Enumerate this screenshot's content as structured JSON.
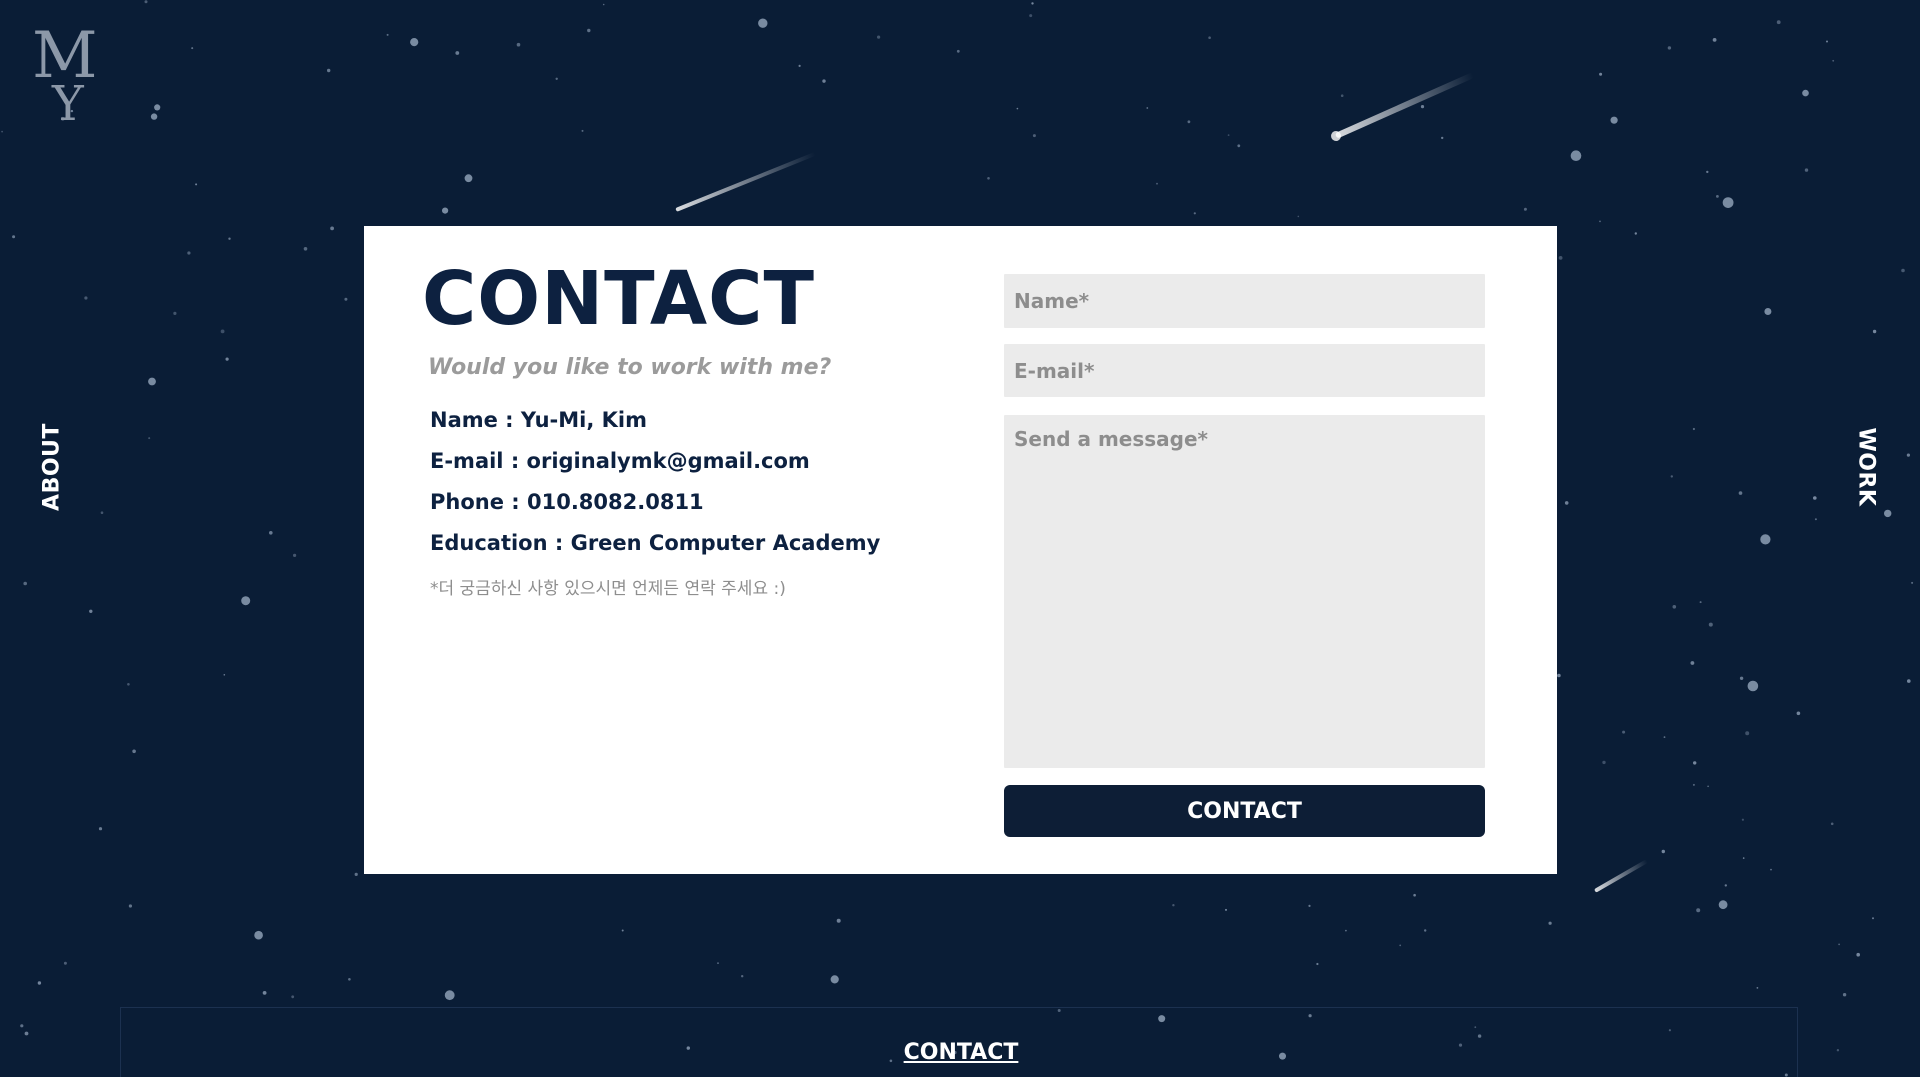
{
  "logo": {
    "letter_top": "M",
    "letter_bottom": "Y"
  },
  "nav": {
    "left_label": "ABOUT",
    "right_label": "WORK"
  },
  "contact": {
    "title": "CONTACT",
    "subtitle": "Would you like to work with me?",
    "info": [
      "Name : Yu-Mi, Kim",
      "E-mail : originalymk@gmail.com",
      "Phone : 010.8082.0811",
      "Education : Green Computer Academy"
    ],
    "note": "*더 궁금하신 사항 있으시면 언제든 연락 주세요 :)"
  },
  "form": {
    "name_placeholder": "Name*",
    "email_placeholder": "E-mail*",
    "message_placeholder": "Send a message*",
    "submit_label": "CONTACT"
  },
  "footer": {
    "link_label": "CONTACT"
  },
  "colors": {
    "background": "#0a1d36",
    "card": "#ffffff",
    "primary_text": "#0d2140",
    "field_bg": "#ebebeb",
    "button_bg": "#0d1e36"
  }
}
